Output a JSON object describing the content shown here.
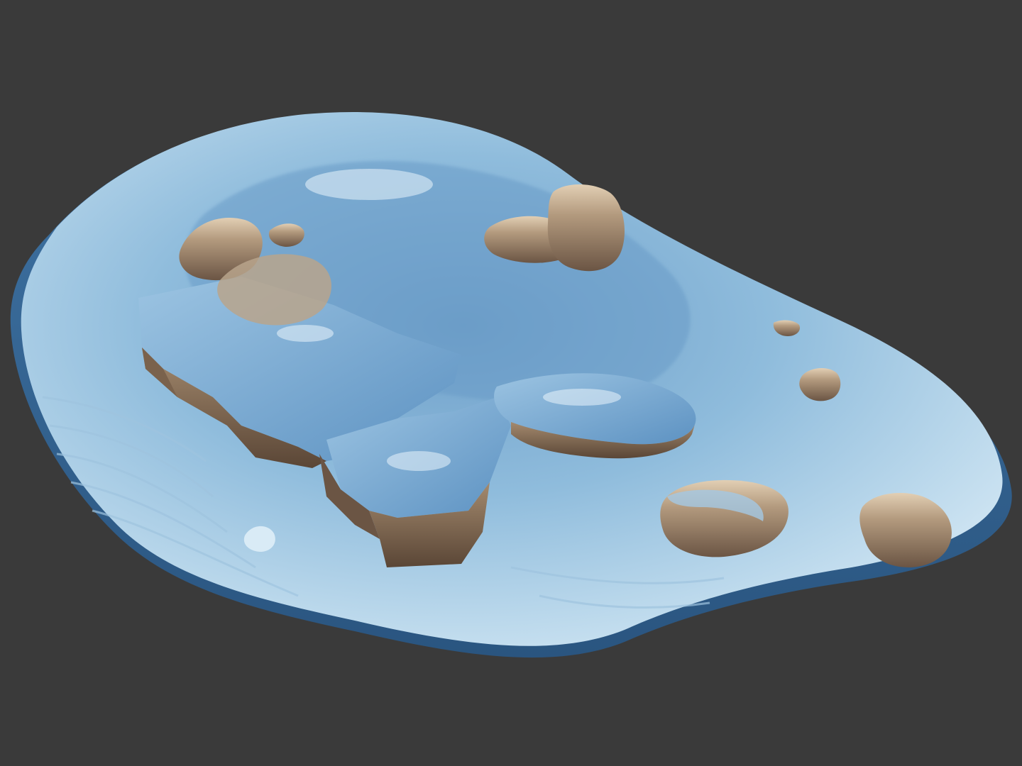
{
  "viewport": {
    "background_color": "#3a3a3a"
  },
  "model": {
    "subject": "3d-scanned-rocky-seabed-mesh",
    "colors": {
      "sediment_light": "#cfe4f2",
      "sediment_mid": "#8fbcdc",
      "sediment_dark": "#4f86b4",
      "rock_light": "#d8c2a6",
      "rock_mid": "#a48a6e",
      "rock_dark": "#5e4a3a"
    }
  }
}
